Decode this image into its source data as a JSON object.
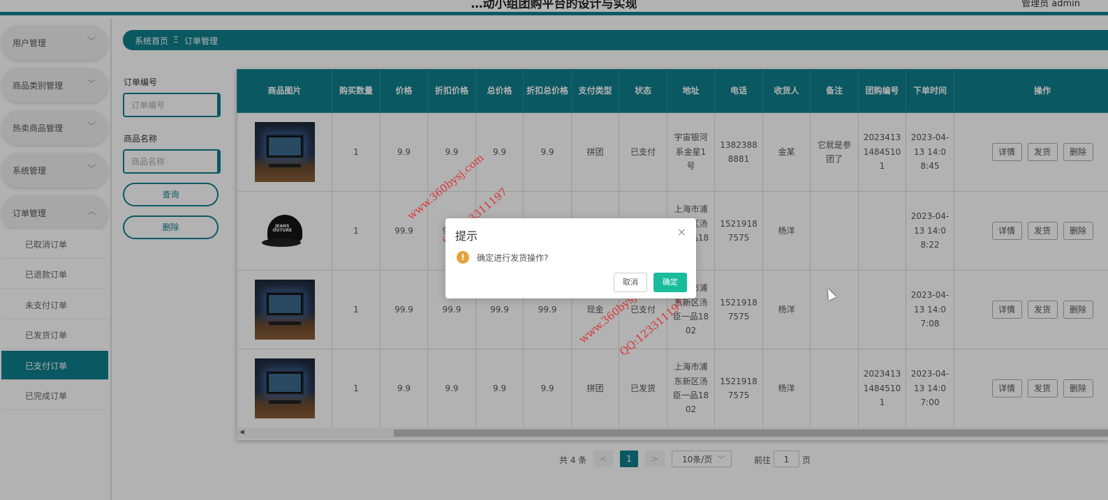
{
  "header": {
    "title": "…动小组团购平台的设计与实现",
    "user": "管理员 admin"
  },
  "sidebar": {
    "groups": [
      {
        "label": "用户管理"
      },
      {
        "label": "商品类别管理"
      },
      {
        "label": "热卖商品管理"
      },
      {
        "label": "系统管理"
      },
      {
        "label": "订单管理"
      }
    ],
    "sub_items": [
      {
        "label": "已取消订单"
      },
      {
        "label": "已退款订单"
      },
      {
        "label": "未支付订单"
      },
      {
        "label": "已发货订单"
      },
      {
        "label": "已支付订单",
        "active": true
      },
      {
        "label": "已完成订单"
      }
    ]
  },
  "breadcrumb": {
    "home": "系统首页",
    "sep": "Ξ",
    "current": "订单管理"
  },
  "filter": {
    "order_no_label": "订单编号",
    "order_no_placeholder": "订单编号",
    "product_name_label": "商品名称",
    "product_name_placeholder": "商品名称",
    "search_label": "查询",
    "delete_label": "删除"
  },
  "table": {
    "columns": [
      "商品图片",
      "购买数量",
      "价格",
      "折扣价格",
      "总价格",
      "折扣总价格",
      "支付类型",
      "状态",
      "地址",
      "电话",
      "收货人",
      "备注",
      "团购编号",
      "下单时间",
      "操作"
    ],
    "rows": [
      {
        "image": "desk",
        "qty": "1",
        "price": "9.9",
        "discount_price": "9.9",
        "total": "9.9",
        "discount_total": "9.9",
        "pay_type": "拼团",
        "status": "已支付",
        "address": "宇宙银河系金星1号",
        "phone": "13823888881",
        "receiver": "金某",
        "remark": "它就是参团了",
        "group_no": "20234131484510 1",
        "time": "2023-04-13 14:08:45"
      },
      {
        "image": "cap",
        "qty": "1",
        "price": "99.9",
        "discount_price": "99.9",
        "total": "99.9",
        "discount_total": "99.9",
        "pay_type": "现金",
        "status": "已支付",
        "address": "上海市浦东新区汤臣一品1802",
        "phone": "15219187575",
        "receiver": "杨洋",
        "remark": "",
        "group_no": "",
        "time": "2023-04-13 14:08:22"
      },
      {
        "image": "desk",
        "qty": "1",
        "price": "99.9",
        "discount_price": "99.9",
        "total": "99.9",
        "discount_total": "99.9",
        "pay_type": "现金",
        "status": "已支付",
        "address": "上海市浦东新区汤臣一品1802",
        "phone": "15219187575",
        "receiver": "杨洋",
        "remark": "",
        "group_no": "",
        "time": "2023-04-13 14:07:08"
      },
      {
        "image": "desk",
        "qty": "1",
        "price": "9.9",
        "discount_price": "9.9",
        "total": "9.9",
        "discount_total": "9.9",
        "pay_type": "拼团",
        "status": "已发货",
        "address": "上海市浦东新区汤臣一品1802",
        "phone": "15219187575",
        "receiver": "杨洋",
        "remark": "",
        "group_no": "20234131484510 1",
        "time": "2023-04-13 14:07:00"
      }
    ],
    "actions": {
      "detail": "详情",
      "ship": "发货",
      "delete": "删除"
    }
  },
  "pagination": {
    "total": "共 4 条",
    "prev": "<",
    "current": "1",
    "next": ">",
    "page_size": "10条/页",
    "goto_prefix": "前往",
    "goto_value": "1",
    "goto_suffix": "页"
  },
  "dialog": {
    "title": "提示",
    "close": "×",
    "icon": "!",
    "message": "确定进行发货操作?",
    "cancel": "取消",
    "confirm": "确定"
  },
  "watermarks": [
    "www.360bysj.com",
    "QQ:123311197"
  ],
  "colors": {
    "primary": "#0f7f8b",
    "confirm": "#1abc9c",
    "warning": "#e6a23c",
    "watermark": "#e02020"
  }
}
